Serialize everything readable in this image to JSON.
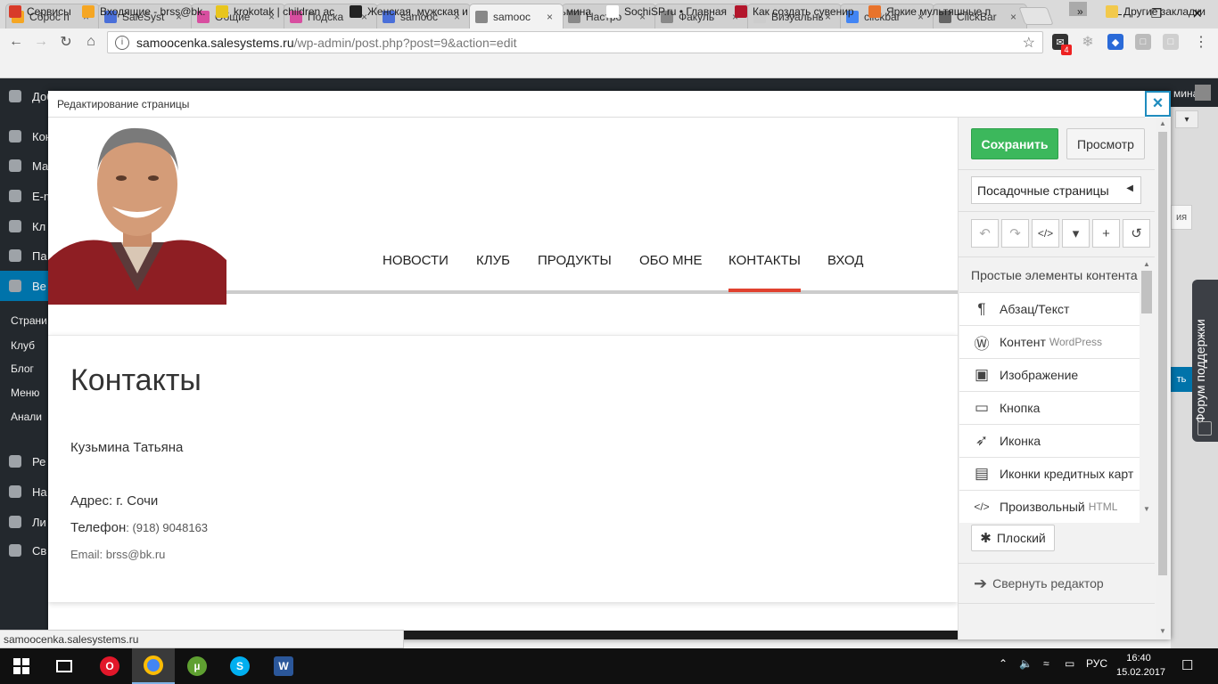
{
  "browser": {
    "tabs": [
      {
        "title": "Сброс п",
        "icon": "mail-icon",
        "color": "#f5a623"
      },
      {
        "title": "SaleSyst",
        "icon": "doc-icon",
        "color": "#4a6fd9"
      },
      {
        "title": "Общие",
        "icon": "ue-icon",
        "color": "#d84ea0"
      },
      {
        "title": "Подска",
        "icon": "ue-icon",
        "color": "#d84ea0"
      },
      {
        "title": "samooc",
        "icon": "doc-icon",
        "color": "#4a6fd9"
      },
      {
        "title": "samooc",
        "icon": "page-icon",
        "color": "#888888",
        "active": true
      },
      {
        "title": "Настро",
        "icon": "page-icon",
        "color": "#888888"
      },
      {
        "title": "Факуль",
        "icon": "page-icon",
        "color": "#888888"
      },
      {
        "title": "Визуальны",
        "icon": "none",
        "color": "#cccccc"
      },
      {
        "title": "clickbar",
        "icon": "google-icon",
        "color": "#4285f4"
      },
      {
        "title": "ClickBar",
        "icon": "search-icon",
        "color": "#666666"
      }
    ],
    "url_host": "samoocenka.salesystems.ru",
    "url_path": "/wp-admin/post.php?post=9&action=edit",
    "ext_badge": "4",
    "bookmarks": [
      {
        "label": "Сервисы",
        "color": "#d83b2a"
      },
      {
        "label": "Входящие - brss@bk.",
        "color": "#f5a623"
      },
      {
        "label": "krokotak | children ac",
        "color": "#e8c51d"
      },
      {
        "label": "Женская, мужская и",
        "color": "#222222"
      },
      {
        "label": "Татьяна Кузьмина",
        "color": "#4a76a8"
      },
      {
        "label": "SochiSP.ru • Главная",
        "color": "#ffffff"
      },
      {
        "label": "Как создать сувенир",
        "color": "#b3162c"
      },
      {
        "label": "Яркие мультяшные п",
        "color": "#e8732c"
      }
    ],
    "bookmarks_overflow": "»",
    "other_bookmarks": "Другие закладки",
    "status_url": "samoocenka.salesystems.ru"
  },
  "wp_admin": {
    "side_items": [
      "Доб",
      "Кон",
      "Ма",
      "E-m",
      "Кл",
      "Па",
      "Ве",
      "Страни",
      "Клуб",
      "Блог",
      "Меню",
      "Анали",
      "Ре",
      "На",
      "Ли",
      "Св"
    ],
    "right_partial": [
      "мина",
      "ия",
      "ть"
    ]
  },
  "modal": {
    "title": "Редактирование страницы",
    "close": "×"
  },
  "site": {
    "nav": [
      "НОВОСТИ",
      "КЛУБ",
      "ПРОДУКТЫ",
      "ОБО МНЕ",
      "КОНТАКТЫ",
      "ВХОД"
    ],
    "active_nav": "КОНТАКТЫ",
    "page_title": "Контакты",
    "name": "Кузьмина Татьяна",
    "address_label": "Адрес",
    "address_value": ": г. Сочи",
    "phone_label": "Телефон",
    "phone_value": ": (918) 9048163",
    "email": "Email: brss@bk.ru",
    "accent": "#e0412f"
  },
  "editor": {
    "save": "Сохранить",
    "preview": "Просмотр",
    "select_value": "Посадочные страницы",
    "tools": [
      {
        "name": "undo-icon",
        "glyph": "↶"
      },
      {
        "name": "redo-icon",
        "glyph": "↷"
      },
      {
        "name": "code-icon",
        "glyph": "</>"
      },
      {
        "name": "archive-icon",
        "glyph": "▾"
      },
      {
        "name": "plus-icon",
        "glyph": "+"
      },
      {
        "name": "history-icon",
        "glyph": "↺"
      }
    ],
    "category": "Простые элементы контента",
    "elements": [
      {
        "label": "Абзац/Текст",
        "sub": "",
        "icon": "paragraph-icon",
        "glyph": "¶"
      },
      {
        "label": "Контент",
        "sub": "WordPress",
        "icon": "wordpress-icon",
        "glyph": "Ⓦ"
      },
      {
        "label": "Изображение",
        "sub": "",
        "icon": "image-icon",
        "glyph": "▣"
      },
      {
        "label": "Кнопка",
        "sub": "",
        "icon": "button-icon",
        "glyph": "▭"
      },
      {
        "label": "Иконка",
        "sub": "",
        "icon": "rocket-icon",
        "glyph": "➶"
      },
      {
        "label": "Иконки кредитных карт",
        "sub": "",
        "icon": "credit-card-icon",
        "glyph": "▤"
      },
      {
        "label": "Произвольный",
        "sub": "HTML",
        "icon": "html-icon",
        "glyph": "</>"
      }
    ],
    "flat_button": "Плоский",
    "collapse": "Свернуть редактор",
    "save_color": "#3cb85c"
  },
  "support_tab": "Форум поддержки",
  "taskbar": {
    "apps": [
      "windows-start-icon",
      "task-view-icon",
      "opera-icon",
      "chrome-icon",
      "utorrent-icon",
      "skype-icon",
      "word-icon"
    ],
    "lang": "РУС",
    "time": "16:40",
    "date": "15.02.2017"
  }
}
